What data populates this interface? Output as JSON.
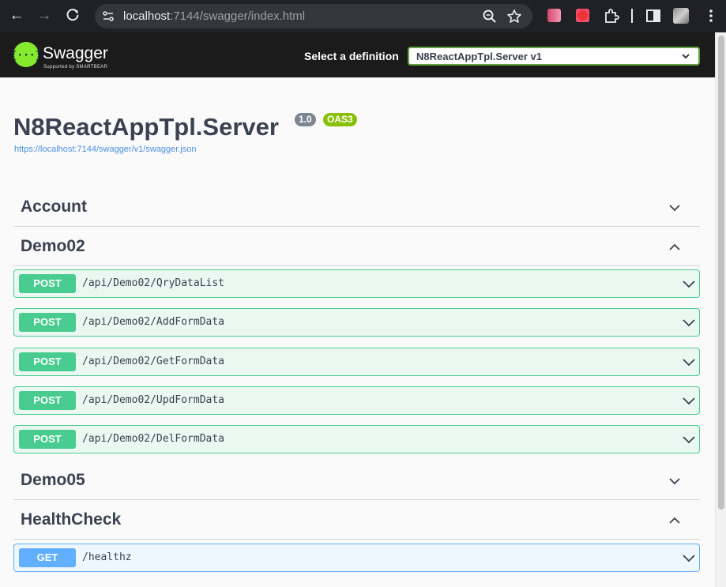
{
  "browser": {
    "url_host": "localhost",
    "url_rest": ":7144/swagger/index.html"
  },
  "topbar": {
    "logo_text": "Swagger",
    "logo_sub": "Supported by SMARTBEAR",
    "definition_label": "Select a definition",
    "definition_value": "N8ReactAppTpl.Server v1"
  },
  "info": {
    "title": "N8ReactAppTpl.Server",
    "version": "1.0",
    "oas": "OAS3",
    "spec_url": "https://localhost:7144/swagger/v1/swagger.json"
  },
  "tags": [
    {
      "name": "Account",
      "expanded": false
    },
    {
      "name": "Demo02",
      "expanded": true
    },
    {
      "name": "Demo05",
      "expanded": false
    },
    {
      "name": "HealthCheck",
      "expanded": true
    }
  ],
  "operations": {
    "demo02": [
      {
        "method": "POST",
        "path": "/api/Demo02/QryDataList"
      },
      {
        "method": "POST",
        "path": "/api/Demo02/AddFormData"
      },
      {
        "method": "POST",
        "path": "/api/Demo02/GetFormData"
      },
      {
        "method": "POST",
        "path": "/api/Demo02/UpdFormData"
      },
      {
        "method": "POST",
        "path": "/api/Demo02/DelFormData"
      }
    ],
    "healthcheck": [
      {
        "method": "GET",
        "path": "/healthz"
      }
    ]
  },
  "colors": {
    "post": "#49cc90",
    "get": "#61affe",
    "swagger_green": "#85ea2d"
  }
}
